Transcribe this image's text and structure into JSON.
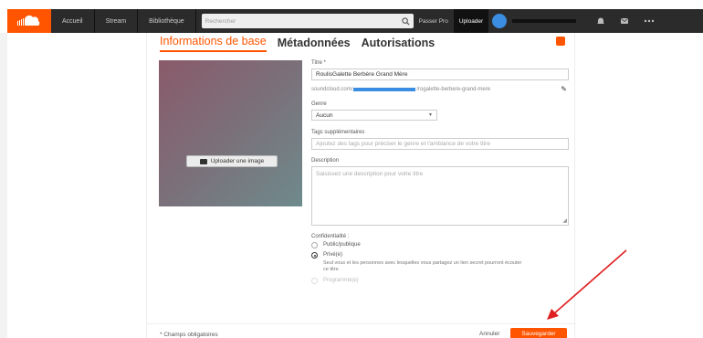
{
  "topbar": {
    "nav": [
      "Accueil",
      "Stream",
      "Bibliothèque"
    ],
    "search_placeholder": "Rechercher",
    "go_pro": "Passer Pro",
    "upload": "Uploader"
  },
  "tabs": [
    {
      "label": "Informations de base",
      "active": true
    },
    {
      "label": "Métadonnées",
      "active": false
    },
    {
      "label": "Autorisations",
      "active": false
    }
  ],
  "artwork": {
    "upload_label": "Uploader une image"
  },
  "form": {
    "title_label": "Titre *",
    "title_value": "RoulisGalette Berbère Grand Mère",
    "permalink_prefix": "soundcloud.com/",
    "permalink_suffix": "/rogalette-berbere-grand-mere",
    "genre_label": "Genre",
    "genre_value": "Aucun",
    "tags_label": "Tags supplémentaires",
    "tags_placeholder": "Ajoutez des tags pour préciser le genre et l'ambiance de votre titre",
    "description_label": "Description",
    "description_placeholder": "Saisissez une description pour votre titre",
    "privacy_label": "Confidentialité :",
    "privacy_options": [
      {
        "label": "Public/publique",
        "checked": false,
        "disabled": false
      },
      {
        "label": "Privé(e)",
        "checked": true,
        "disabled": false,
        "helper": "Seul vous et les personnes avec lesquelles vous partagez un lien secret pourront écouter ce titre."
      },
      {
        "label": "Programmé(e)",
        "checked": false,
        "disabled": true
      }
    ]
  },
  "footer": {
    "required_note": "* Champs obligatoires",
    "cancel": "Annuler",
    "save": "Sauvegarder"
  },
  "colors": {
    "accent": "#ff5500",
    "topbar": "#2b2b2b",
    "annotation_arrow": "#e02020"
  }
}
